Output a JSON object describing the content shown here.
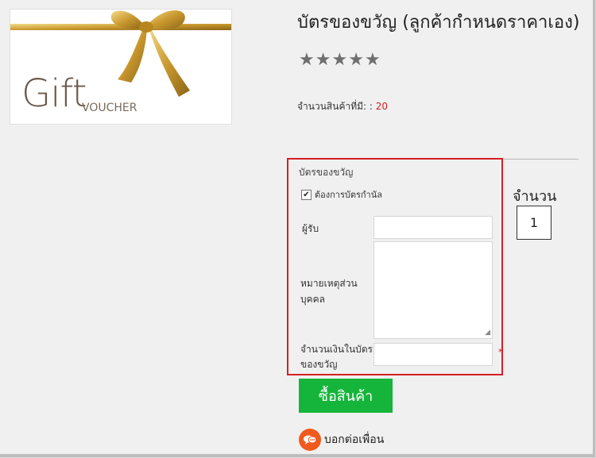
{
  "product": {
    "title": "บัตรของขวัญ (ลูกค้ากำหนดราคาเอง)",
    "image_text_main": "Gift",
    "image_text_sub": "VOUCHER",
    "rating_stars": 0,
    "rating_max": 5,
    "stock_label": "จำนวนสินค้าที่มี: :",
    "stock_value": "20"
  },
  "gift_card_form": {
    "title": "บัตรของขวัญ",
    "physical_card_label": "ต้องการบัตรกำนัล",
    "physical_card_checked": true,
    "recipient_label": "ผู้รับ",
    "recipient_value": "",
    "message_label_line1": "หมายเหตุส่วน",
    "message_label_line2": "บุคคล",
    "message_value": "",
    "amount_label_line1": "จำนวนเงินในบัตร",
    "amount_label_line2": "ของขวัญ",
    "amount_value": "",
    "required_marker": "*"
  },
  "quantity": {
    "label": "จำนวน",
    "value": "1"
  },
  "actions": {
    "buy_label": "ซื้อสินค้า",
    "share_label": "บอกต่อเพื่อน"
  },
  "colors": {
    "buy_button": "#14b53a",
    "highlight_border": "#d41f26",
    "stock_value": "#d32020",
    "share_icon": "#f05a1e"
  },
  "icons": {
    "star": "star-icon",
    "share": "chat-bubbles-icon",
    "checkbox": "checkbox"
  }
}
